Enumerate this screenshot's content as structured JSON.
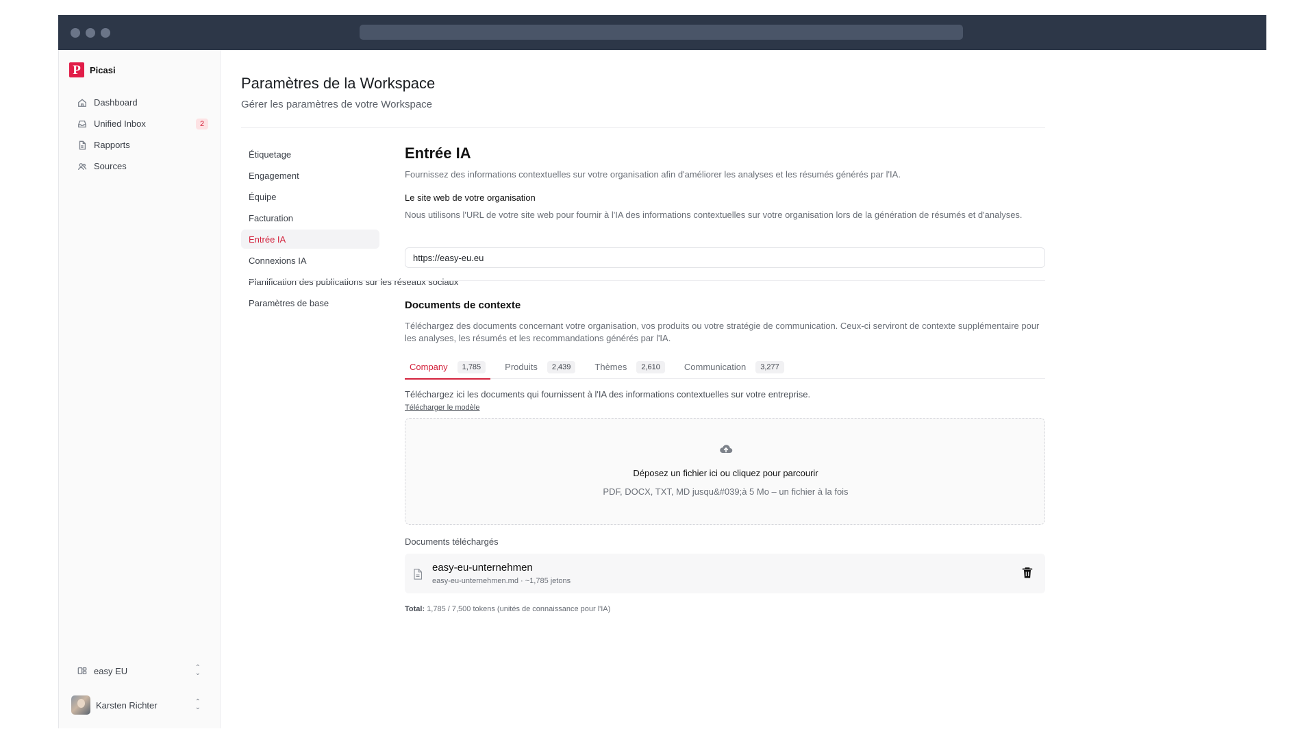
{
  "app": {
    "name": "Picasi",
    "logo_letter": "P",
    "accent_color": "#d3223c"
  },
  "sidebar": {
    "items": [
      {
        "label": "Dashboard",
        "icon": "home-icon"
      },
      {
        "label": "Unified Inbox",
        "icon": "inbox-icon",
        "badge": "2"
      },
      {
        "label": "Rapports",
        "icon": "file-icon"
      },
      {
        "label": "Sources",
        "icon": "users-icon"
      }
    ],
    "workspace": {
      "label": "easy EU",
      "icon": "workspace-icon"
    },
    "user": {
      "name": "Karsten Richter"
    }
  },
  "page": {
    "title": "Paramètres de la Workspace",
    "subtitle": "Gérer les paramètres de votre Workspace"
  },
  "settings_nav": {
    "items": [
      "Étiquetage",
      "Engagement",
      "Équipe",
      "Facturation",
      "Entrée IA",
      "Connexions IA",
      "Planification des publications sur les réseaux sociaux",
      "Paramètres de base"
    ],
    "active": "Entrée IA"
  },
  "ai_input": {
    "title": "Entrée IA",
    "description": "Fournissez des informations contextuelles sur votre organisation afin d'améliorer les analyses et les résumés générés par l'IA.",
    "website": {
      "label": "Le site web de votre organisation",
      "help": "Nous utilisons l'URL de votre site web pour fournir à l'IA des informations contextuelles sur votre organisation lors de la génération de résumés et d'analyses.",
      "value": "https://easy-eu.eu"
    },
    "documents": {
      "title": "Documents de contexte",
      "description": "Téléchargez des documents concernant votre organisation, vos produits ou votre stratégie de communication. Ceux-ci serviront de contexte supplémentaire pour les analyses, les résumés et les recommandations générés par l'IA.",
      "tabs": [
        {
          "label": "Company",
          "count": "1,785",
          "active": true
        },
        {
          "label": "Produits",
          "count": "2,439",
          "active": false
        },
        {
          "label": "Thèmes",
          "count": "2,610",
          "active": false
        },
        {
          "label": "Communication",
          "count": "3,277",
          "active": false
        }
      ],
      "tab_description": "Téléchargez ici les documents qui fournissent à l'IA des informations contextuelles sur votre entreprise.",
      "template_link": "Télécharger le modèle",
      "dropzone": {
        "title": "Déposez un fichier ici ou cliquez pour parcourir",
        "subtitle": "PDF, DOCX, TXT, MD jusqu&#039;à 5 Mo – un fichier à la fois",
        "icon": "cloud-upload-icon"
      },
      "uploaded_title": "Documents téléchargés",
      "files": [
        {
          "name": "easy-eu-unternehmen",
          "meta": "easy-eu-unternehmen.md · ~1,785 jetons"
        }
      ],
      "total_label": "Total:",
      "total_value": "1,785 / 7,500 tokens (unités de connaissance pour l'IA)"
    }
  }
}
